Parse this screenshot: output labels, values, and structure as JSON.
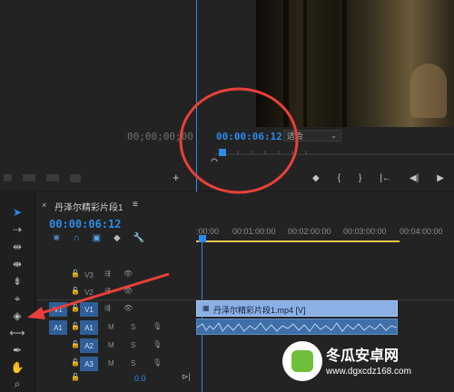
{
  "source_monitor": {
    "timecode": "00;00;00;00"
  },
  "program_monitor": {
    "timecode": "00:00:06:12",
    "zoom": "适合"
  },
  "timeline": {
    "tab_title": "丹泽尔精彩片段1",
    "playhead_time": "00:00:06:12",
    "ruler_labels": [
      ":00:00",
      "00:01:00:00",
      "00:02:00:00",
      "00:03:00:00",
      "00:04:00:00"
    ],
    "tracks": [
      {
        "name": "V3",
        "target": ""
      },
      {
        "name": "V2",
        "target": ""
      },
      {
        "name": "V1",
        "target": "V1"
      },
      {
        "name": "A1",
        "target": "A1"
      },
      {
        "name": "A2",
        "target": ""
      },
      {
        "name": "A3",
        "target": ""
      }
    ],
    "mute_label": "M",
    "solo_label": "S",
    "video_clip": "丹泽尔精彩片段1.mp4 [V]",
    "master_volume": "0.0"
  },
  "watermark": {
    "brand": "冬瓜安卓网",
    "url": "www.dgxcdz168.com"
  },
  "colors": {
    "accent": "#2d8ceb",
    "annotation": "#e8403a",
    "clip_video": "#8ab0e6",
    "clip_audio": "#3e6fa8"
  }
}
